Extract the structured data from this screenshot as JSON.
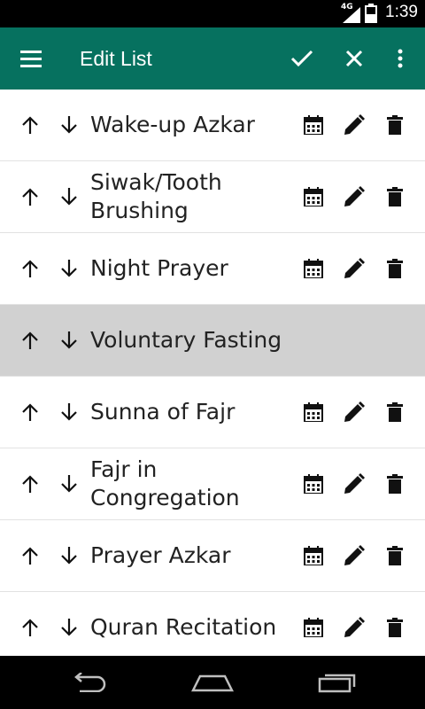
{
  "status_bar": {
    "time": "1:39",
    "network": "4G"
  },
  "app_bar": {
    "title": "Edit List",
    "background": "#06715f",
    "menu_icon": "menu-icon",
    "confirm_icon": "check-icon",
    "cancel_icon": "close-icon",
    "overflow_icon": "more-vert-icon"
  },
  "items": [
    {
      "label": "Wake-up Azkar",
      "selected": false
    },
    {
      "label": "Siwak/Tooth Brushing",
      "selected": false
    },
    {
      "label": "Night Prayer",
      "selected": false
    },
    {
      "label": "Voluntary Fasting",
      "selected": true
    },
    {
      "label": "Sunna of Fajr",
      "selected": false
    },
    {
      "label": "Fajr in Congregation",
      "selected": false
    },
    {
      "label": "Prayer Azkar",
      "selected": false
    },
    {
      "label": "Quran Recitation",
      "selected": false
    }
  ],
  "nav_bar": {
    "back_icon": "back-icon",
    "home_icon": "home-icon",
    "recents_icon": "recents-icon"
  }
}
